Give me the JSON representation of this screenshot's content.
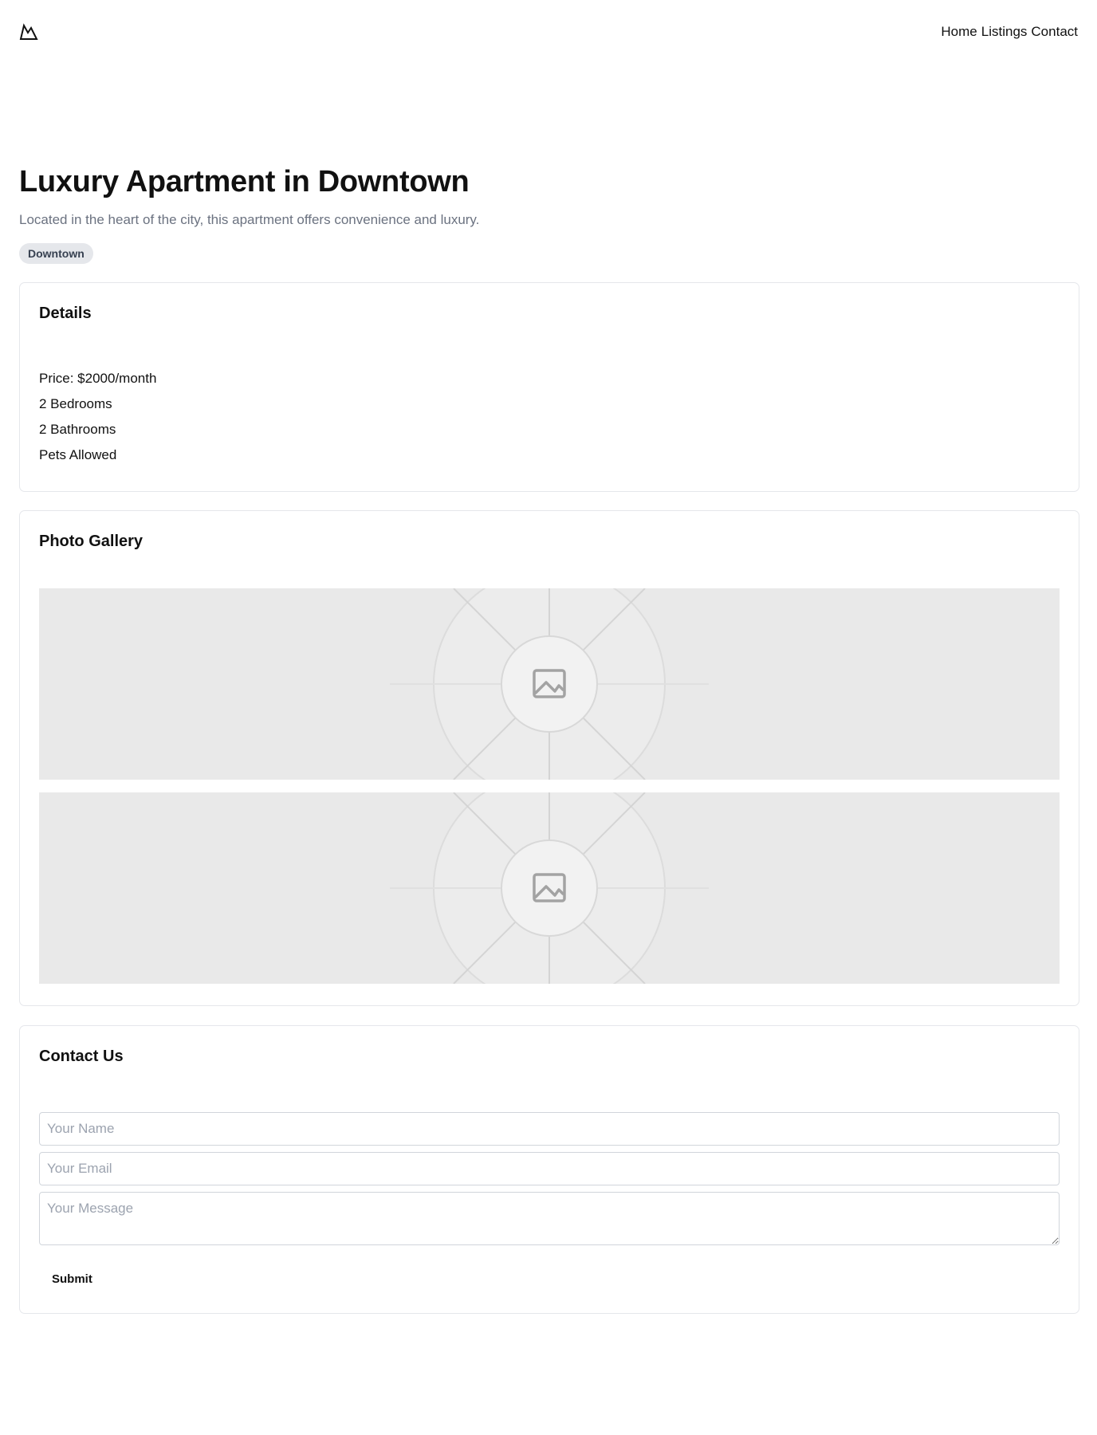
{
  "nav": {
    "logo_icon": "mountain-logo-icon",
    "links": [
      "Home",
      "Listings",
      "Contact"
    ]
  },
  "listing": {
    "title": "Luxury Apartment in Downtown",
    "description": "Located in the heart of the city, this apartment offers convenience and luxury.",
    "tag": "Downtown"
  },
  "details": {
    "heading": "Details",
    "items": [
      "Price: $2000/month",
      "2 Bedrooms",
      "2 Bathrooms",
      "Pets Allowed"
    ]
  },
  "gallery": {
    "heading": "Photo Gallery",
    "photo_icon": "image-placeholder-icon",
    "photo_count": 2
  },
  "contact": {
    "heading": "Contact Us",
    "name_placeholder": "Your Name",
    "email_placeholder": "Your Email",
    "message_placeholder": "Your Message",
    "submit_label": "Submit"
  },
  "colors": {
    "text": "#111111",
    "muted_text": "#6b7280",
    "badge_bg": "#e5e7eb",
    "border": "#e5e7eb",
    "placeholder_bg": "#e9e9e9"
  }
}
